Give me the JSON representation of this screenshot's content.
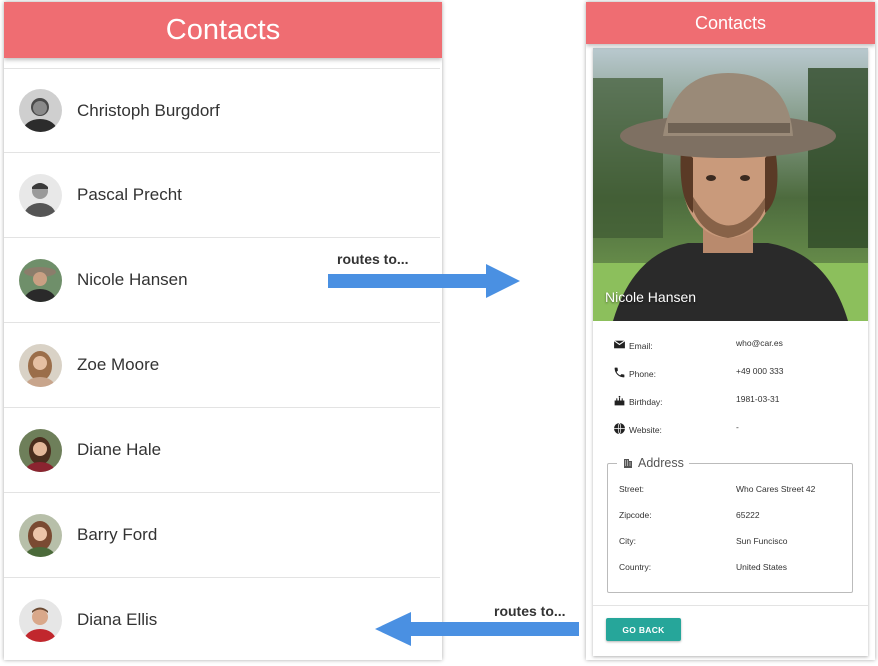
{
  "left": {
    "header_title": "Contacts",
    "contacts": [
      {
        "name": "Christoph Burgdorf"
      },
      {
        "name": "Pascal Precht"
      },
      {
        "name": "Nicole Hansen"
      },
      {
        "name": "Zoe Moore"
      },
      {
        "name": "Diane Hale"
      },
      {
        "name": "Barry Ford"
      },
      {
        "name": "Diana Ellis"
      }
    ]
  },
  "annotations": {
    "route_forward": "routes to...",
    "route_back": "routes to...",
    "arrow_color": "#4a90e2"
  },
  "right": {
    "header_title": "Contacts",
    "photo_name": "Nicole Hansen",
    "details": {
      "email_label": "Email:",
      "email_value": "who@car.es",
      "phone_label": "Phone:",
      "phone_value": "+49 000 333",
      "birthday_label": "Birthday:",
      "birthday_value": "1981-03-31",
      "website_label": "Website:",
      "website_value": "-"
    },
    "address": {
      "legend": "Address",
      "street_label": "Street:",
      "street_value": "Who Cares Street 42",
      "zipcode_label": "Zipcode:",
      "zipcode_value": "65222",
      "city_label": "City:",
      "city_value": "Sun Funcisco",
      "country_label": "Country:",
      "country_value": "United States"
    },
    "go_back_label": "GO BACK"
  },
  "colors": {
    "header": "#ef6d72",
    "button": "#26a69a"
  },
  "icons": [
    "email-icon",
    "phone-icon",
    "cake-icon",
    "globe-icon",
    "building-icon"
  ]
}
